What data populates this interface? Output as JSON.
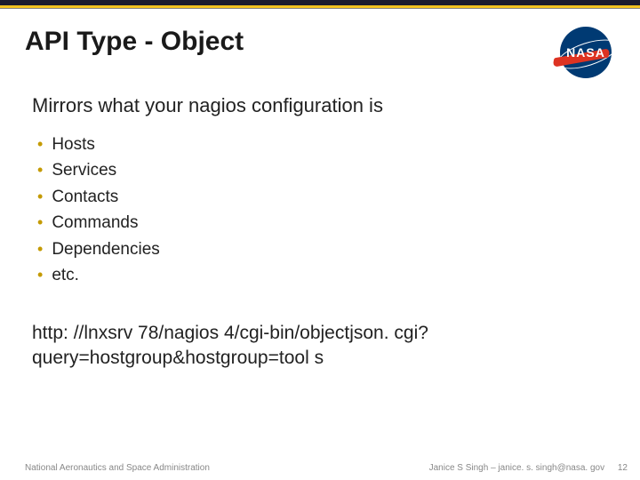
{
  "header": {
    "title": "API Type - Object",
    "logo_text": "NASA"
  },
  "subtitle": "Mirrors what your nagios configuration is",
  "bullets": [
    "Hosts",
    "Services",
    "Contacts",
    "Commands",
    "Dependencies",
    "etc."
  ],
  "url": "http: //lnxsrv 78/nagios 4/cgi-bin/objectjson. cgi? query=hostgroup&hostgroup=tool s",
  "footer": {
    "left": "National Aeronautics and Space Administration",
    "right": "Janice S Singh – janice. s. singh@nasa. gov",
    "page": "12"
  }
}
